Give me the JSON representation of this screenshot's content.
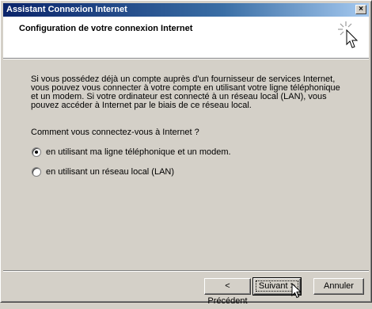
{
  "window": {
    "title": "Assistant Connexion Internet",
    "close_glyph": "×"
  },
  "header": {
    "title": "Configuration de votre connexion Internet",
    "icon": "sparkle-cursor-icon"
  },
  "content": {
    "intro": "Si vous possédez déjà un compte auprès d'un fournisseur de services Internet, vous pouvez vous connecter à votre compte en utilisant votre ligne téléphonique et un modem. Si votre ordinateur est connecté à un réseau local (LAN), vous pouvez accéder à Internet par le biais de ce réseau local.",
    "question": "Comment vous connectez-vous à Internet ?",
    "options": [
      {
        "label": "en utilisant ma ligne téléphonique et un modem.",
        "selected": true
      },
      {
        "label": "en utilisant un réseau local (LAN)",
        "selected": false
      }
    ]
  },
  "buttons": {
    "prev": "< Précédent",
    "next": "Suivant >",
    "cancel": "Annuler"
  }
}
